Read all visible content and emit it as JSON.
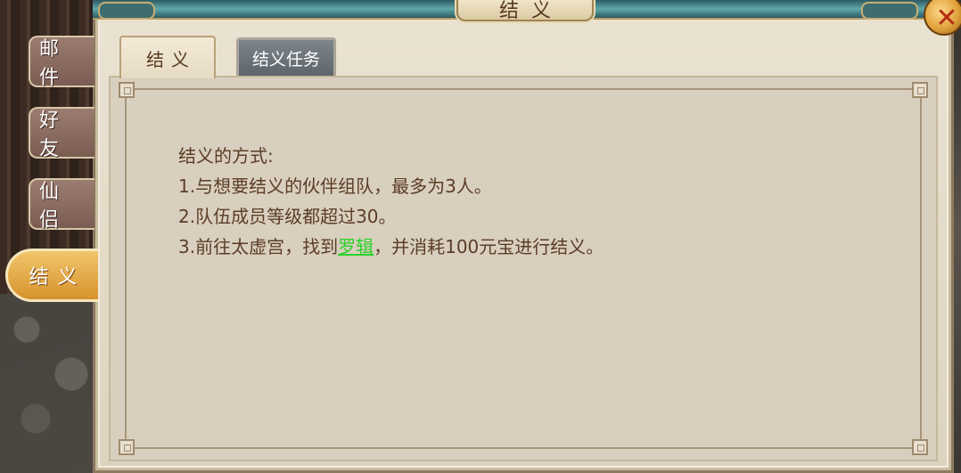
{
  "window": {
    "title": "结义"
  },
  "side_tabs": [
    {
      "label": "邮件",
      "active": false
    },
    {
      "label": "好友",
      "active": false
    },
    {
      "label": "仙侣",
      "active": false
    },
    {
      "label": "结义",
      "active": true
    }
  ],
  "tabs": [
    {
      "label": "结义",
      "active": true
    },
    {
      "label": "结义任务",
      "active": false
    }
  ],
  "content": {
    "heading": "结义的方式:",
    "line1": "1.与想要结义的伙伴组队，最多为3人。",
    "line2": "2.队伍成员等级都超过30。",
    "line3_prefix": "3.前往太虚宫，找到",
    "line3_link": "罗辑",
    "line3_suffix": "，并消耗100元宝进行结义。"
  },
  "icons": {
    "close": "close-icon"
  },
  "colors": {
    "link": "#2bd22b",
    "text": "#5b3d28",
    "active_tab": "#d6922c"
  }
}
